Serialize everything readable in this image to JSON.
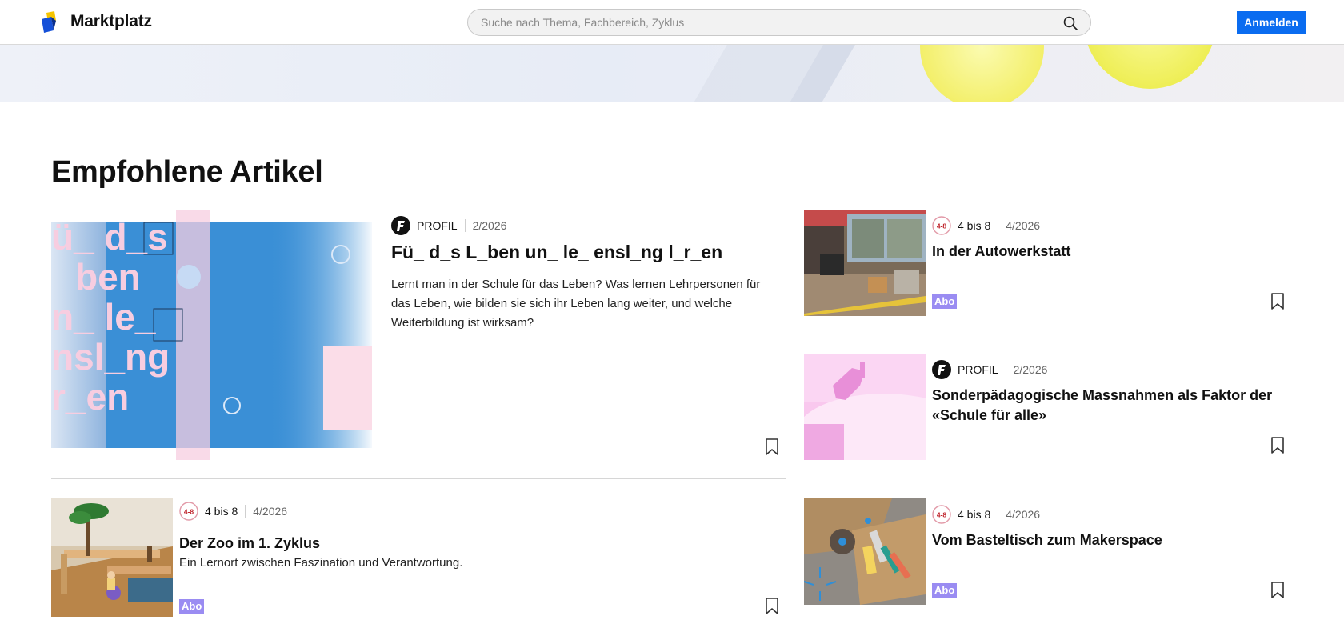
{
  "header": {
    "brand": "Marktplatz",
    "search_placeholder": "Suche nach Thema, Fachbereich, Zyklus",
    "login_label": "Anmelden"
  },
  "section": {
    "title": "Empfohlene Artikel"
  },
  "featured": {
    "publication": "PROFIL",
    "issue": "2/2026",
    "title": "Fü_ d_s L_ben un_ le_ ensl_ng l_r_en",
    "description": "Lernt man in der Schule für das Leben? Was lernen Lehrpersonen für das Leben, wie bilden sie sich ihr Leben lang weiter, und welche Weiterbildung ist wirksam?",
    "cover_text": [
      "ü_ d_s",
      "ben",
      "n_ le_",
      "nsl_ng",
      "r_en"
    ]
  },
  "articles": [
    {
      "publication": "4 bis 8",
      "badge_text": "4-8",
      "issue": "4/2026",
      "title": "In der Autowerkstatt",
      "abo": "Abo"
    },
    {
      "publication": "PROFIL",
      "issue": "2/2026",
      "title": "Sonderpädagogische Massnahmen als Faktor der «Schule für alle»"
    },
    {
      "publication": "4 bis 8",
      "badge_text": "4-8",
      "issue": "4/2026",
      "title": "Der Zoo im 1. Zyklus",
      "description": "Ein Lernort zwischen Faszination und Verantwortung.",
      "abo": "Abo"
    },
    {
      "publication": "4 bis 8",
      "badge_text": "4-8",
      "issue": "4/2026",
      "title": "Vom Basteltisch zum Makerspace",
      "abo": "Abo"
    }
  ],
  "colors": {
    "accent": "#0a6cf0",
    "abo_badge": "#9a8cf2",
    "cover_blue": "#3a8fd6",
    "cover_pink": "#fbdde8"
  }
}
